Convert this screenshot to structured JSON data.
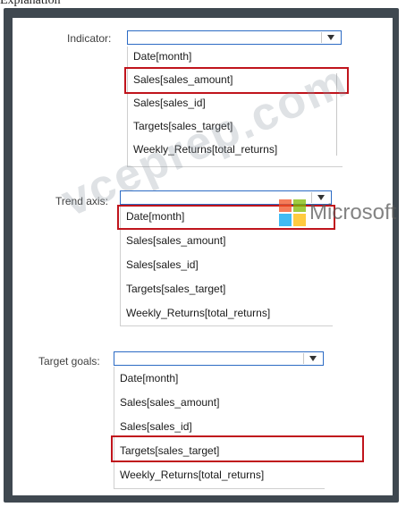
{
  "caption": "Explanation",
  "sections": [
    {
      "label": "Indicator:",
      "items": [
        "Date[month]",
        "Sales[sales_amount]",
        "Sales[sales_id]",
        "Targets[sales_target]",
        "Weekly_Returns[total_returns]"
      ],
      "highlighted_index": 1
    },
    {
      "label": "Trend axis:",
      "items": [
        "Date[month]",
        "Sales[sales_amount]",
        "Sales[sales_id]",
        "Targets[sales_target]",
        "Weekly_Returns[total_returns]"
      ],
      "highlighted_index": 0
    },
    {
      "label": "Target goals:",
      "items": [
        "Date[month]",
        "Sales[sales_amount]",
        "Sales[sales_id]",
        "Targets[sales_target]",
        "Weekly_Returns[total_returns]"
      ],
      "highlighted_index": 3
    }
  ],
  "watermark": {
    "text": "vceprep.com",
    "brand": "Microsoft",
    "logo_colors": [
      "#f25022",
      "#7fba00",
      "#00a4ef",
      "#ffb900"
    ]
  },
  "colors": {
    "highlight": "#c0141c",
    "frame": "#3f4850"
  }
}
